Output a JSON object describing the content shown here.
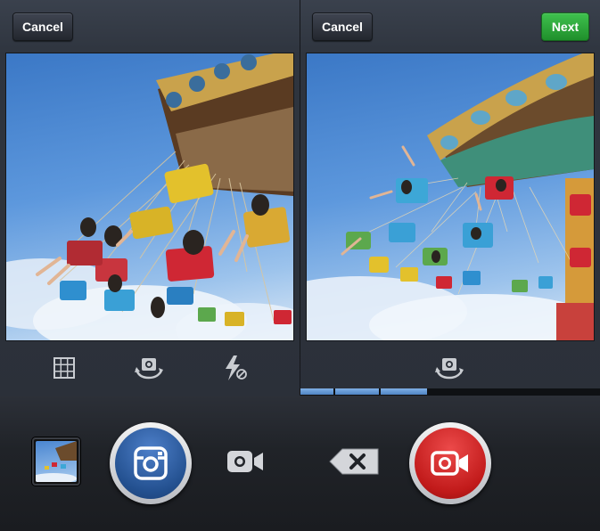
{
  "left": {
    "cancel_label": "Cancel"
  },
  "right": {
    "cancel_label": "Cancel",
    "next_label": "Next"
  },
  "icons": {
    "grid": "grid-icon",
    "flip_camera": "flip-camera-icon",
    "flash_off": "flash-off-icon",
    "video_mode": "video-camera-icon",
    "delete_clip": "delete-backspace-icon",
    "camera_shutter": "camera-icon",
    "record": "video-record-icon"
  },
  "colors": {
    "next_green": "#2fa83c",
    "shutter_blue": "#2a5a9c",
    "record_red": "#d42222",
    "progress_blue": "#5f93d2"
  },
  "video_progress": {
    "segments_recorded": 3,
    "fraction": 0.43
  }
}
